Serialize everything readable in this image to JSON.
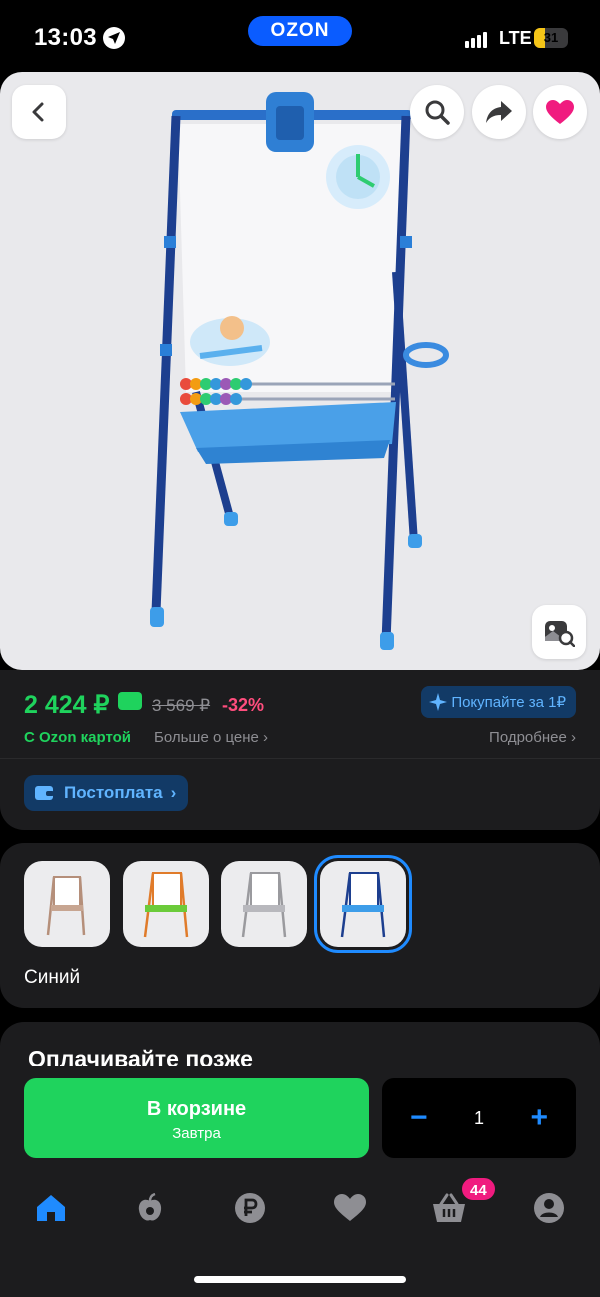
{
  "status_bar": {
    "time": "13:03",
    "carrier": "LTE",
    "battery": "31",
    "battery_level": 0.31,
    "brand": "OZON"
  },
  "product": {
    "price": "2 424 ₽",
    "old_price": "3 569 ₽",
    "discount": "-32%",
    "promo": "Покупайте за 1₽",
    "with_card": "С Ozon картой",
    "price_more": "Больше о цене",
    "details": "Подробнее",
    "postpay": "Постоплата"
  },
  "variants": {
    "selected_color": "Синий"
  },
  "pay_later": {
    "title": "Оплачивайте позже"
  },
  "action": {
    "cart_label": "В корзине",
    "cart_sub": "Завтра",
    "quantity": "1"
  },
  "tabbar": {
    "cart_badge": "44"
  },
  "colors": {
    "accent_green": "#1fd35d",
    "accent_blue": "#1f8bff",
    "discount_pink": "#ff4d7d",
    "badge_pink": "#f01b7f",
    "background": "#1c1c1e"
  },
  "icons": {
    "back": "back-icon",
    "search": "search-icon",
    "share": "share-icon",
    "favorite": "heart-icon",
    "image_search": "image-search-icon",
    "home": "home-icon",
    "fresh": "fresh-icon",
    "finance": "ruble-icon",
    "favorites": "heart-tab-icon",
    "cart": "basket-icon",
    "profile": "profile-icon"
  }
}
